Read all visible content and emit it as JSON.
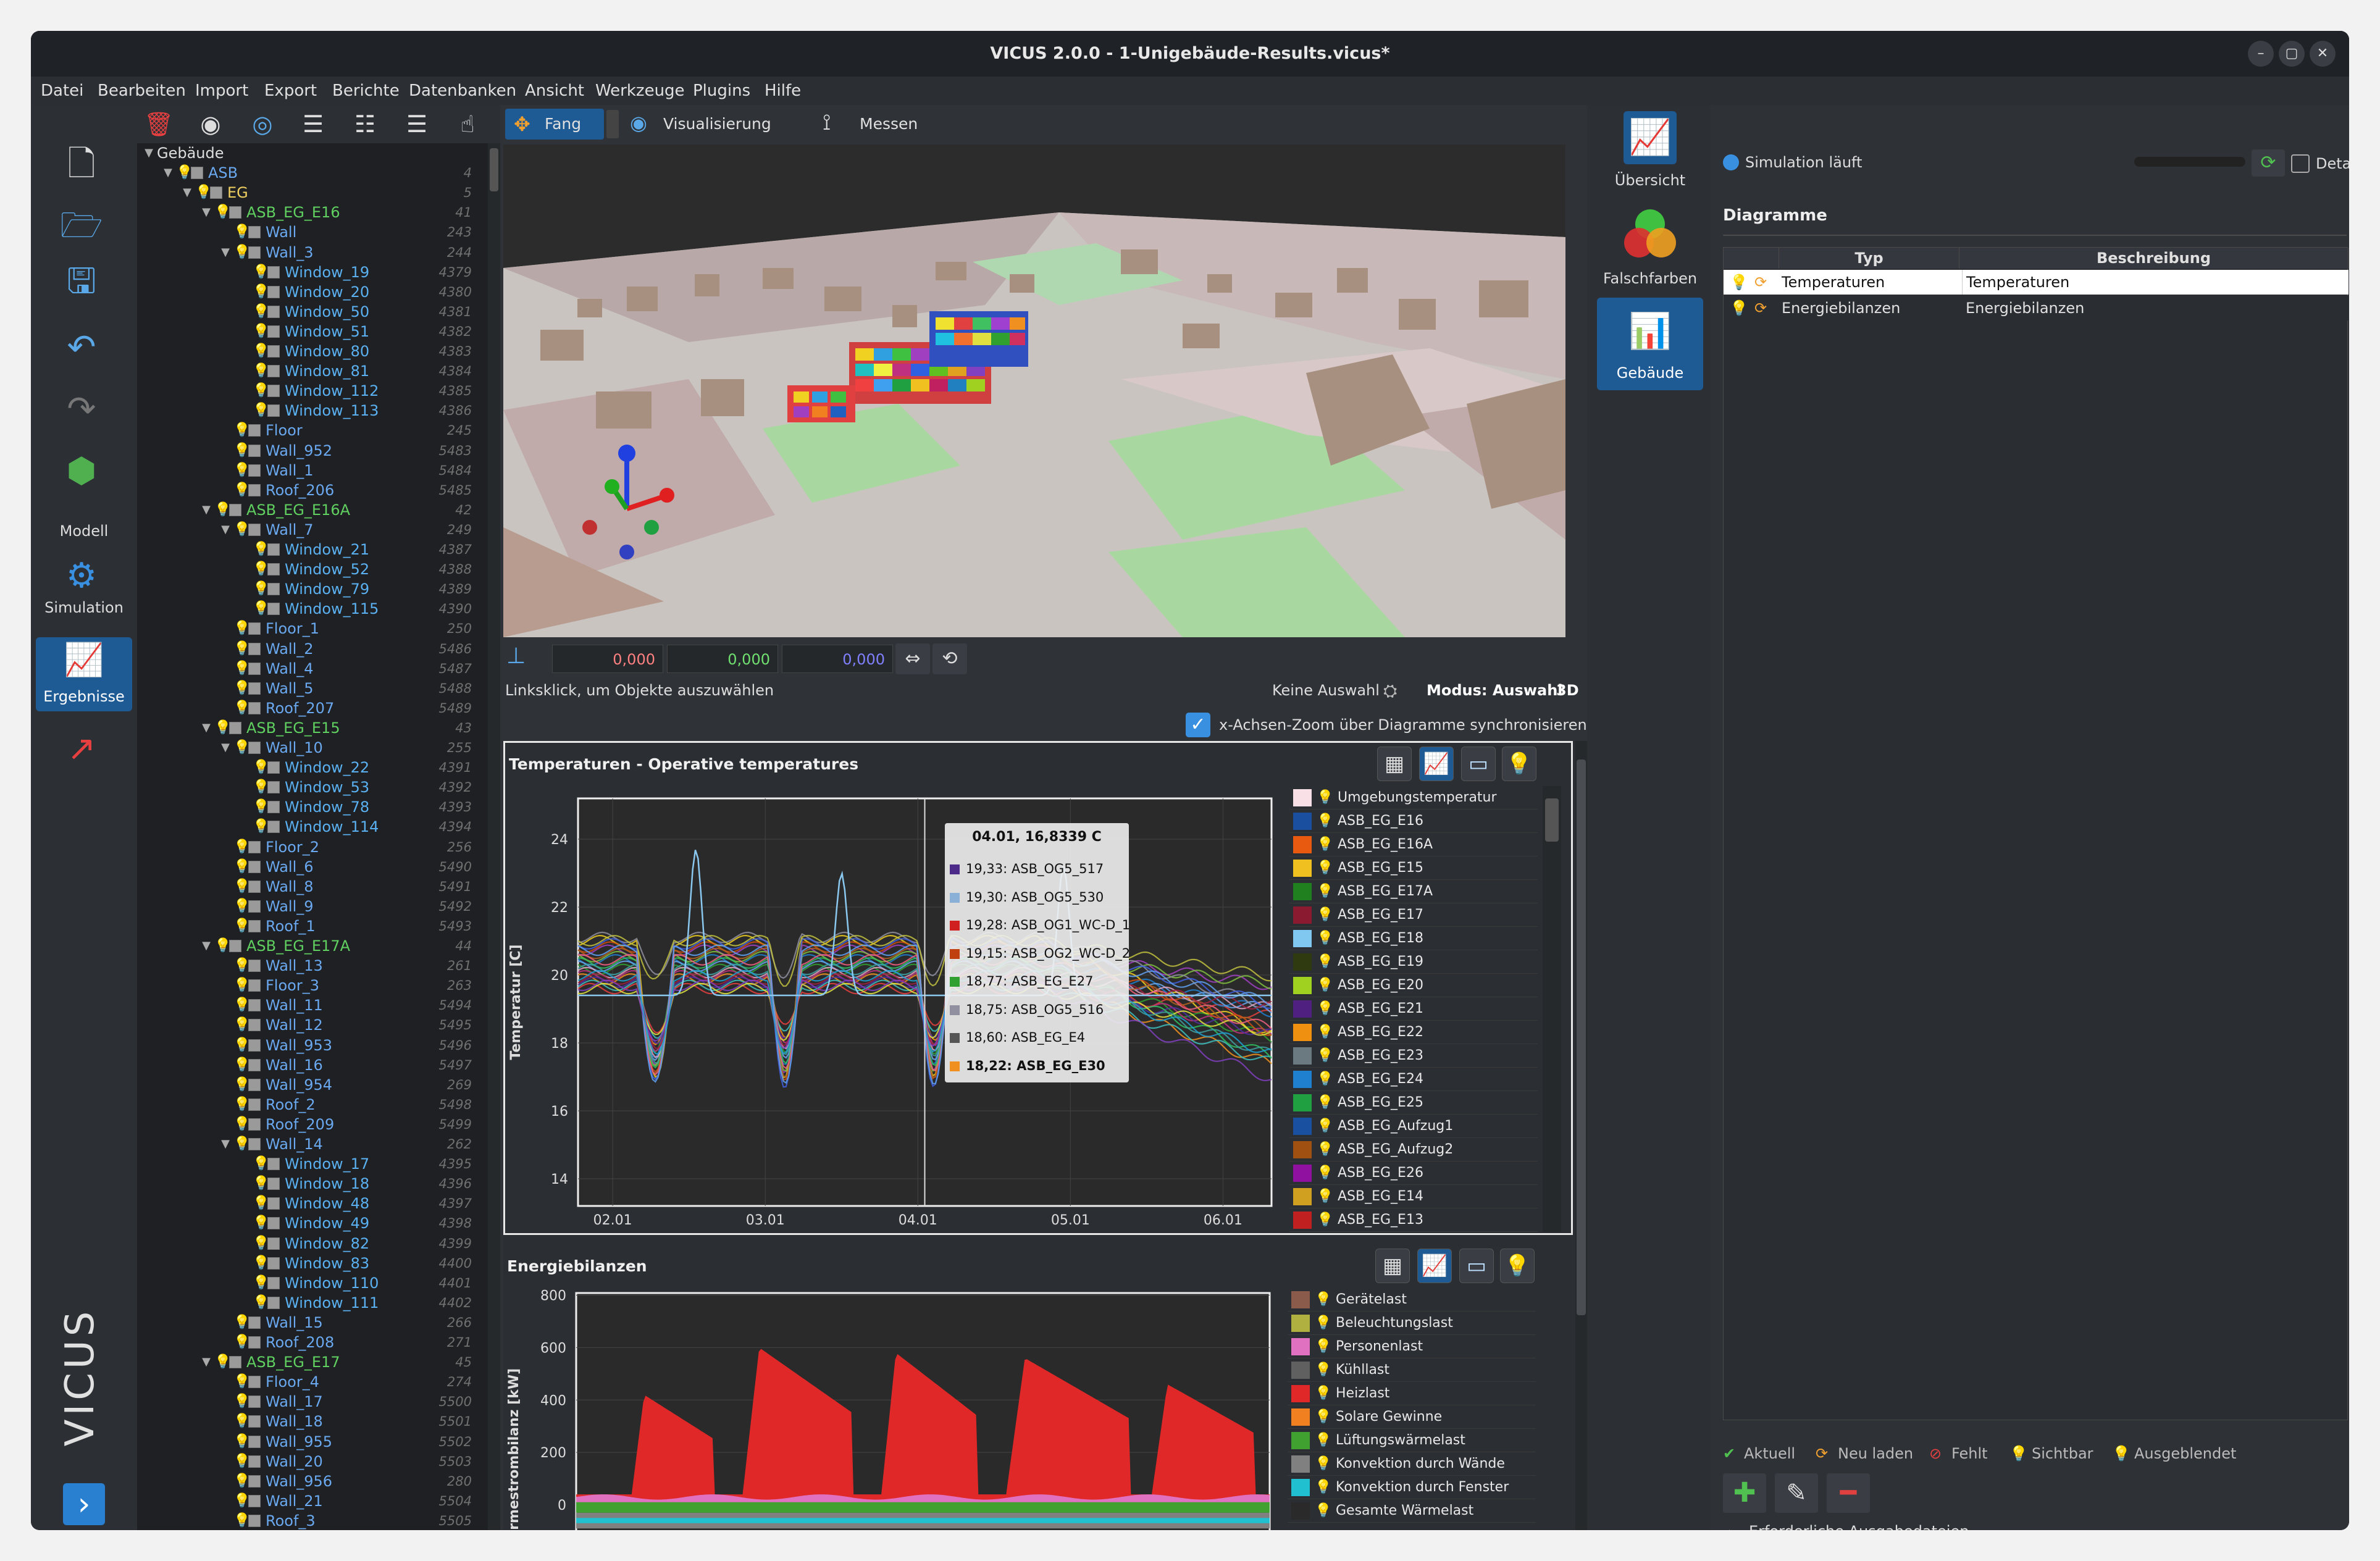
{
  "window": {
    "title": "VICUS 2.0.0 - 1-Unigebäude-Results.vicus*",
    "min": "–",
    "max": "▢",
    "close": "✕"
  },
  "menu": [
    "Datei",
    "Bearbeiten",
    "Import",
    "Export",
    "Berichte",
    "Datenbanken",
    "Ansicht",
    "Werkzeuge",
    "Plugins",
    "Hilfe"
  ],
  "left_toolbar": {
    "modell": "Modell",
    "simulation": "Simulation",
    "ergebnisse": "Ergebnisse",
    "brand": "VICUS"
  },
  "tree": {
    "rows": [
      {
        "d": 0,
        "n": "Gebäude",
        "num": "",
        "t": "root",
        "a": "▼"
      },
      {
        "d": 1,
        "n": "ASB",
        "num": "4",
        "t": "node",
        "a": "▼"
      },
      {
        "d": 2,
        "n": "EG",
        "num": "5",
        "t": "level",
        "a": "▼"
      },
      {
        "d": 3,
        "n": "ASB_EG_E16",
        "num": "41",
        "t": "room",
        "a": "▼"
      },
      {
        "d": 4,
        "n": "Wall",
        "num": "243",
        "t": "surf",
        "a": ""
      },
      {
        "d": 4,
        "n": "Wall_3",
        "num": "244",
        "t": "surf",
        "a": "▼"
      },
      {
        "d": 5,
        "n": "Window_19",
        "num": "4379",
        "t": "win",
        "a": ""
      },
      {
        "d": 5,
        "n": "Window_20",
        "num": "4380",
        "t": "win",
        "a": ""
      },
      {
        "d": 5,
        "n": "Window_50",
        "num": "4381",
        "t": "win",
        "a": ""
      },
      {
        "d": 5,
        "n": "Window_51",
        "num": "4382",
        "t": "win",
        "a": ""
      },
      {
        "d": 5,
        "n": "Window_80",
        "num": "4383",
        "t": "win",
        "a": ""
      },
      {
        "d": 5,
        "n": "Window_81",
        "num": "4384",
        "t": "win",
        "a": ""
      },
      {
        "d": 5,
        "n": "Window_112",
        "num": "4385",
        "t": "win",
        "a": ""
      },
      {
        "d": 5,
        "n": "Window_113",
        "num": "4386",
        "t": "win",
        "a": ""
      },
      {
        "d": 4,
        "n": "Floor",
        "num": "245",
        "t": "surf",
        "a": ""
      },
      {
        "d": 4,
        "n": "Wall_952",
        "num": "5483",
        "t": "surf",
        "a": ""
      },
      {
        "d": 4,
        "n": "Wall_1",
        "num": "5484",
        "t": "surf",
        "a": ""
      },
      {
        "d": 4,
        "n": "Roof_206",
        "num": "5485",
        "t": "surf",
        "a": ""
      },
      {
        "d": 3,
        "n": "ASB_EG_E16A",
        "num": "42",
        "t": "room",
        "a": "▼"
      },
      {
        "d": 4,
        "n": "Wall_7",
        "num": "249",
        "t": "surf",
        "a": "▼"
      },
      {
        "d": 5,
        "n": "Window_21",
        "num": "4387",
        "t": "win",
        "a": ""
      },
      {
        "d": 5,
        "n": "Window_52",
        "num": "4388",
        "t": "win",
        "a": ""
      },
      {
        "d": 5,
        "n": "Window_79",
        "num": "4389",
        "t": "win",
        "a": ""
      },
      {
        "d": 5,
        "n": "Window_115",
        "num": "4390",
        "t": "win",
        "a": ""
      },
      {
        "d": 4,
        "n": "Floor_1",
        "num": "250",
        "t": "surf",
        "a": ""
      },
      {
        "d": 4,
        "n": "Wall_2",
        "num": "5486",
        "t": "surf",
        "a": ""
      },
      {
        "d": 4,
        "n": "Wall_4",
        "num": "5487",
        "t": "surf",
        "a": ""
      },
      {
        "d": 4,
        "n": "Wall_5",
        "num": "5488",
        "t": "surf",
        "a": ""
      },
      {
        "d": 4,
        "n": "Roof_207",
        "num": "5489",
        "t": "surf",
        "a": ""
      },
      {
        "d": 3,
        "n": "ASB_EG_E15",
        "num": "43",
        "t": "room",
        "a": "▼"
      },
      {
        "d": 4,
        "n": "Wall_10",
        "num": "255",
        "t": "surf",
        "a": "▼"
      },
      {
        "d": 5,
        "n": "Window_22",
        "num": "4391",
        "t": "win",
        "a": ""
      },
      {
        "d": 5,
        "n": "Window_53",
        "num": "4392",
        "t": "win",
        "a": ""
      },
      {
        "d": 5,
        "n": "Window_78",
        "num": "4393",
        "t": "win",
        "a": ""
      },
      {
        "d": 5,
        "n": "Window_114",
        "num": "4394",
        "t": "win",
        "a": ""
      },
      {
        "d": 4,
        "n": "Floor_2",
        "num": "256",
        "t": "surf",
        "a": ""
      },
      {
        "d": 4,
        "n": "Wall_6",
        "num": "5490",
        "t": "surf",
        "a": ""
      },
      {
        "d": 4,
        "n": "Wall_8",
        "num": "5491",
        "t": "surf",
        "a": ""
      },
      {
        "d": 4,
        "n": "Wall_9",
        "num": "5492",
        "t": "surf",
        "a": ""
      },
      {
        "d": 4,
        "n": "Roof_1",
        "num": "5493",
        "t": "surf",
        "a": ""
      },
      {
        "d": 3,
        "n": "ASB_EG_E17A",
        "num": "44",
        "t": "room",
        "a": "▼"
      },
      {
        "d": 4,
        "n": "Wall_13",
        "num": "261",
        "t": "surf",
        "a": ""
      },
      {
        "d": 4,
        "n": "Floor_3",
        "num": "263",
        "t": "surf",
        "a": ""
      },
      {
        "d": 4,
        "n": "Wall_11",
        "num": "5494",
        "t": "surf",
        "a": ""
      },
      {
        "d": 4,
        "n": "Wall_12",
        "num": "5495",
        "t": "surf",
        "a": ""
      },
      {
        "d": 4,
        "n": "Wall_953",
        "num": "5496",
        "t": "surf",
        "a": ""
      },
      {
        "d": 4,
        "n": "Wall_16",
        "num": "5497",
        "t": "surf",
        "a": ""
      },
      {
        "d": 4,
        "n": "Wall_954",
        "num": "269",
        "t": "surf",
        "a": ""
      },
      {
        "d": 4,
        "n": "Roof_2",
        "num": "5498",
        "t": "surf",
        "a": ""
      },
      {
        "d": 4,
        "n": "Roof_209",
        "num": "5499",
        "t": "surf",
        "a": ""
      },
      {
        "d": 4,
        "n": "Wall_14",
        "num": "262",
        "t": "surf",
        "a": "▼"
      },
      {
        "d": 5,
        "n": "Window_17",
        "num": "4395",
        "t": "win",
        "a": ""
      },
      {
        "d": 5,
        "n": "Window_18",
        "num": "4396",
        "t": "win",
        "a": ""
      },
      {
        "d": 5,
        "n": "Window_48",
        "num": "4397",
        "t": "win",
        "a": ""
      },
      {
        "d": 5,
        "n": "Window_49",
        "num": "4398",
        "t": "win",
        "a": ""
      },
      {
        "d": 5,
        "n": "Window_82",
        "num": "4399",
        "t": "win",
        "a": ""
      },
      {
        "d": 5,
        "n": "Window_83",
        "num": "4400",
        "t": "win",
        "a": ""
      },
      {
        "d": 5,
        "n": "Window_110",
        "num": "4401",
        "t": "win",
        "a": ""
      },
      {
        "d": 5,
        "n": "Window_111",
        "num": "4402",
        "t": "win",
        "a": ""
      },
      {
        "d": 4,
        "n": "Wall_15",
        "num": "266",
        "t": "surf",
        "a": ""
      },
      {
        "d": 4,
        "n": "Roof_208",
        "num": "271",
        "t": "surf",
        "a": ""
      },
      {
        "d": 3,
        "n": "ASB_EG_E17",
        "num": "45",
        "t": "room",
        "a": "▼"
      },
      {
        "d": 4,
        "n": "Floor_4",
        "num": "274",
        "t": "surf",
        "a": ""
      },
      {
        "d": 4,
        "n": "Wall_17",
        "num": "5500",
        "t": "surf",
        "a": ""
      },
      {
        "d": 4,
        "n": "Wall_18",
        "num": "5501",
        "t": "surf",
        "a": ""
      },
      {
        "d": 4,
        "n": "Wall_955",
        "num": "5502",
        "t": "surf",
        "a": ""
      },
      {
        "d": 4,
        "n": "Wall_20",
        "num": "5503",
        "t": "surf",
        "a": ""
      },
      {
        "d": 4,
        "n": "Wall_956",
        "num": "280",
        "t": "surf",
        "a": ""
      },
      {
        "d": 4,
        "n": "Wall_21",
        "num": "5504",
        "t": "surf",
        "a": ""
      },
      {
        "d": 4,
        "n": "Roof_3",
        "num": "5505",
        "t": "surf",
        "a": ""
      }
    ]
  },
  "viewport_toolbar": {
    "fang": "Fang",
    "visualisierung": "Visualisierung",
    "messen": "Messen"
  },
  "coords": {
    "x": "0,000",
    "y": "0,000",
    "z": "0,000",
    "hint": "Linksklick, um Objekte auszuwählen",
    "selection": "Keine Auswahl",
    "mode": "Modus: Auswahl",
    "view": "3D"
  },
  "sync_label": "x-Achsen-Zoom über Diagramme synchronisieren",
  "charts": {
    "temp": {
      "title": "Temperaturen - Operative temperatures",
      "ylabel": "Temperatur [C]",
      "xticks": [
        "02.01",
        "03.01",
        "04.01",
        "05.01",
        "06.01"
      ],
      "yticks": [
        "14",
        "16",
        "18",
        "20",
        "22",
        "24"
      ],
      "tooltip": {
        "header": "04.01, 16,8339 C",
        "rows": [
          {
            "t": "19,33: ASB_OG5_517",
            "c": "#4b2a8a"
          },
          {
            "t": "19,30: ASB_OG5_530",
            "c": "#8ab0d8"
          },
          {
            "t": "19,28: ASB_OG1_WC-D_1",
            "c": "#d02020"
          },
          {
            "t": "19,15: ASB_OG2_WC-D_2",
            "c": "#c04010"
          },
          {
            "t": "18,77: ASB_EG_E27",
            "c": "#30a030"
          },
          {
            "t": "18,75: ASB_OG5_516",
            "c": "#9090a0"
          },
          {
            "t": "18,60: ASB_EG_E4",
            "c": "#555555"
          },
          {
            "t": "18,22: ASB_EG_E30",
            "c": "#f09020"
          }
        ]
      },
      "legend": [
        {
          "name": "Umgebungstemperatur",
          "color": "#f8e0e6"
        },
        {
          "name": "ASB_EG_E16",
          "color": "#1a4fa0"
        },
        {
          "name": "ASB_EG_E16A",
          "color": "#e85a10"
        },
        {
          "name": "ASB_EG_E15",
          "color": "#f0c020"
        },
        {
          "name": "ASB_EG_E17A",
          "color": "#208020"
        },
        {
          "name": "ASB_EG_E17",
          "color": "#8a1a30"
        },
        {
          "name": "ASB_EG_E18",
          "color": "#80c8f0"
        },
        {
          "name": "ASB_EG_E19",
          "color": "#303a10"
        },
        {
          "name": "ASB_EG_E20",
          "color": "#a0d020"
        },
        {
          "name": "ASB_EG_E21",
          "color": "#502080"
        },
        {
          "name": "ASB_EG_E22",
          "color": "#f09010"
        },
        {
          "name": "ASB_EG_E23",
          "color": "#6a7a80"
        },
        {
          "name": "ASB_EG_E24",
          "color": "#2080d0"
        },
        {
          "name": "ASB_EG_E25",
          "color": "#20a040"
        },
        {
          "name": "ASB_EG_Aufzug1",
          "color": "#1a50a0"
        },
        {
          "name": "ASB_EG_Aufzug2",
          "color": "#a05010"
        },
        {
          "name": "ASB_EG_E26",
          "color": "#9010a0"
        },
        {
          "name": "ASB_EG_E14",
          "color": "#d0a020"
        },
        {
          "name": "ASB_EG_E13",
          "color": "#c02020"
        }
      ]
    },
    "energy": {
      "title": "Energiebilanzen",
      "ylabel": "Wärmestrombilanz [kW]",
      "yticks": [
        "0",
        "200",
        "400",
        "600",
        "800"
      ],
      "legend": [
        {
          "name": "Gerätelast",
          "color": "#8a5a4a"
        },
        {
          "name": "Beleuchtungslast",
          "color": "#b0b040"
        },
        {
          "name": "Personenlast",
          "color": "#e070c0"
        },
        {
          "name": "Kühllast",
          "color": "#606060"
        },
        {
          "name": "Heizlast",
          "color": "#e02828"
        },
        {
          "name": "Solare Gewinne",
          "color": "#f08020"
        },
        {
          "name": "Lüftungswärmelast",
          "color": "#40a030"
        },
        {
          "name": "Konvektion durch Wände",
          "color": "#808080"
        },
        {
          "name": "Konvektion durch Fenster",
          "color": "#20c0d0"
        },
        {
          "name": "Gesamte Wärmelast",
          "color": "#2a2a2a"
        }
      ]
    }
  },
  "nav": {
    "uebersicht": "Übersicht",
    "falschfarben": "Falschfarben",
    "gebaeude": "Gebäude"
  },
  "right": {
    "sim_status": "Simulation läuft",
    "details": "Details",
    "diagramme": "Diagramme",
    "col_typ": "Typ",
    "col_beschreibung": "Beschreibung",
    "rows": [
      {
        "typ": "Temperaturen",
        "desc": "Temperaturen"
      },
      {
        "typ": "Energiebilanzen",
        "desc": "Energiebilanzen"
      }
    ],
    "status": {
      "aktuell": "Aktuell",
      "neu": "Neu laden",
      "fehlt": "Fehlt",
      "sichtbar": "Sichtbar",
      "ausgeblendet": "Ausgeblendet"
    },
    "required": "Erforderliche Ausgabedateien"
  }
}
